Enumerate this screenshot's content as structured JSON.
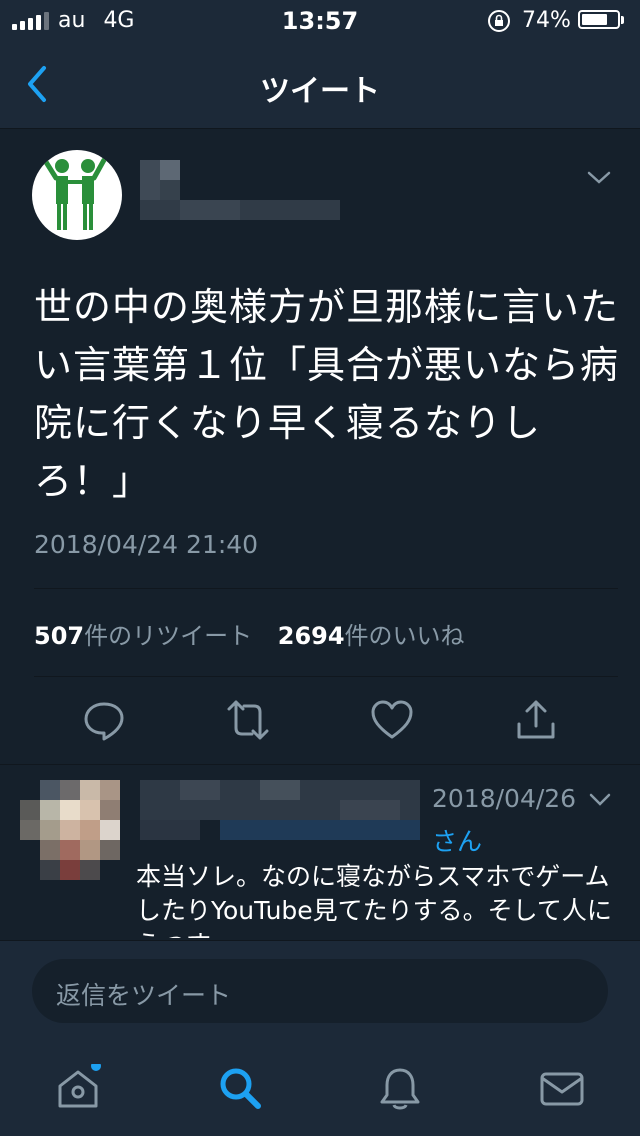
{
  "status_bar": {
    "carrier": "au",
    "network": "4G",
    "time": "13:57",
    "battery": "74%",
    "battery_level": 0.74
  },
  "nav": {
    "title": "ツイート",
    "back_icon": "chevron-left-icon"
  },
  "tweet": {
    "text": "世の中の奥様方が旦那様に言いたい言葉第１位「具合が悪いなら病院に行くなり早く寝るなりしろ！」",
    "timestamp": "2018/04/24 21:40",
    "stats": {
      "retweet_count": "507",
      "retweet_label": "件のリツイート",
      "like_count": "2694",
      "like_label": "件のいいね"
    },
    "actions": [
      "reply-icon",
      "retweet-icon",
      "like-icon",
      "share-icon"
    ]
  },
  "reply": {
    "date": "2018/04/26",
    "suffix": "さん",
    "text": "本当ソレ。なのに寝ながらスマホでゲームしたりYouTube見てたりする。そして人にうつす"
  },
  "compose": {
    "placeholder": "返信をツイート"
  },
  "tab_bar": {
    "items": [
      "home-icon",
      "search-icon",
      "notifications-icon",
      "messages-icon"
    ],
    "active": "search-icon"
  },
  "colors": {
    "background": "#15202b",
    "bar": "#1c2938",
    "accent": "#1da1f2",
    "secondary_text": "#8899a6"
  }
}
